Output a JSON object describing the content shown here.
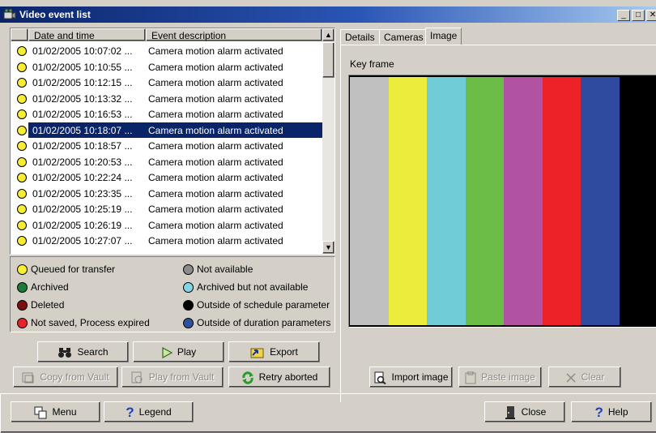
{
  "window": {
    "title": "Video event list",
    "icon": "camera-app-icon"
  },
  "list": {
    "columns": [
      "Date and time",
      "Event description"
    ],
    "rows": [
      {
        "date": "01/02/2005 10:07:02 ...",
        "event": "Camera motion alarm activated"
      },
      {
        "date": "01/02/2005 10:10:55 ...",
        "event": "Camera motion alarm activated"
      },
      {
        "date": "01/02/2005 10:12:15 ...",
        "event": "Camera motion alarm activated"
      },
      {
        "date": "01/02/2005 10:13:32 ...",
        "event": "Camera motion alarm activated"
      },
      {
        "date": "01/02/2005 10:16:53 ...",
        "event": "Camera motion alarm activated"
      },
      {
        "date": "01/02/2005 10:18:07 ...",
        "event": "Camera motion alarm activated",
        "selected": true
      },
      {
        "date": "01/02/2005 10:18:57 ...",
        "event": "Camera motion alarm activated"
      },
      {
        "date": "01/02/2005 10:20:53 ...",
        "event": "Camera motion alarm activated"
      },
      {
        "date": "01/02/2005 10:22:24 ...",
        "event": "Camera motion alarm activated"
      },
      {
        "date": "01/02/2005 10:23:35 ...",
        "event": "Camera motion alarm activated"
      },
      {
        "date": "01/02/2005 10:25:19 ...",
        "event": "Camera motion alarm activated"
      },
      {
        "date": "01/02/2005 10:26:19 ...",
        "event": "Camera motion alarm activated"
      },
      {
        "date": "01/02/2005 10:27:07 ...",
        "event": "Camera motion alarm activated"
      }
    ],
    "status_color": "#f7ee33"
  },
  "legend": [
    {
      "label": "Queued for transfer",
      "color": "#f7ee33"
    },
    {
      "label": "Not available",
      "color": "#8c8c8c"
    },
    {
      "label": "Archived",
      "color": "#1d7a3a"
    },
    {
      "label": "Archived but not available",
      "color": "#7fd6e6"
    },
    {
      "label": "Deleted",
      "color": "#7a1010"
    },
    {
      "label": "Outside of schedule parameter",
      "color": "#000000"
    },
    {
      "label": "Not saved, Process expired",
      "color": "#e8222a"
    },
    {
      "label": "Outside of duration parameters",
      "color": "#2f4fa0"
    }
  ],
  "actions": {
    "search": "Search",
    "play": "Play",
    "export": "Export",
    "copy_from_vault": "Copy from Vault",
    "play_from_vault": "Play from Vault",
    "retry_aborted": "Retry aborted"
  },
  "tabs": [
    "Details",
    "Cameras",
    "Image"
  ],
  "active_tab": "Image",
  "image": {
    "label": "Key frame",
    "bar_colors": [
      "#c0c0c0",
      "#ecec3c",
      "#70cdd8",
      "#6cbc48",
      "#b252a2",
      "#ec2228",
      "#2f4b9f",
      "#000000"
    ],
    "import_label": "Import image",
    "paste_label": "Paste image",
    "clear_label": "Clear"
  },
  "footer": {
    "menu": "Menu",
    "legend": "Legend",
    "close": "Close",
    "help": "Help"
  }
}
